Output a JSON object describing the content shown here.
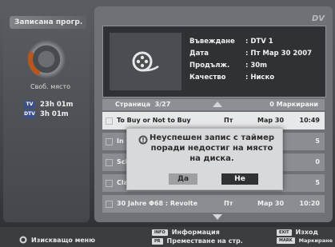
{
  "left_panel": {
    "title": "Записана прогр.",
    "free_space_label": "Своб. място",
    "stats": [
      {
        "badge": "TV",
        "value": "23h 01m"
      },
      {
        "badge": "DTV",
        "value": "3h 01m"
      }
    ]
  },
  "logo": "DV",
  "info": {
    "input_label": "Въвеждане",
    "input_value": ": DTV 1",
    "date_label": "Дата",
    "date_value": ": Пт Мар 30 2007",
    "duration_label": "Продълж.",
    "duration_value": ": 30m",
    "quality_label": "Качество",
    "quality_value": ": Ниско"
  },
  "page": {
    "label": "Страница",
    "value": "3/27",
    "marks": "0 Маркирани"
  },
  "list": [
    {
      "title": "To Buy or Not to Buy",
      "day": "Пт",
      "date": "Мар 30",
      "time": "10:49",
      "selected": true
    },
    {
      "title": "In t",
      "day": "",
      "date": "",
      "time": "5",
      "selected": false
    },
    {
      "title": "Sch",
      "day": "",
      "date": "",
      "time": "0",
      "selected": false
    },
    {
      "title": "Cla",
      "day": "",
      "date": "",
      "time": "5",
      "selected": false
    },
    {
      "title": "30 Jahre Φ68 : Revolte",
      "day": "Пт",
      "date": "Мар 30",
      "time": "10:20",
      "selected": false
    }
  ],
  "dialog": {
    "message": "Неуспешен запис с таймер поради недостиг на място на диска.",
    "yes": "Да",
    "no": "Не"
  },
  "bottom": {
    "left": "Изискващо меню",
    "info_tag": "INFO",
    "info_label": "Информация",
    "pr_tag": "PR",
    "pr_label": "Преместване на стр.",
    "exit_tag": "EXIT",
    "exit_label": "Изход",
    "mark_tag": "MARK",
    "mark_label": "Маркиране"
  }
}
